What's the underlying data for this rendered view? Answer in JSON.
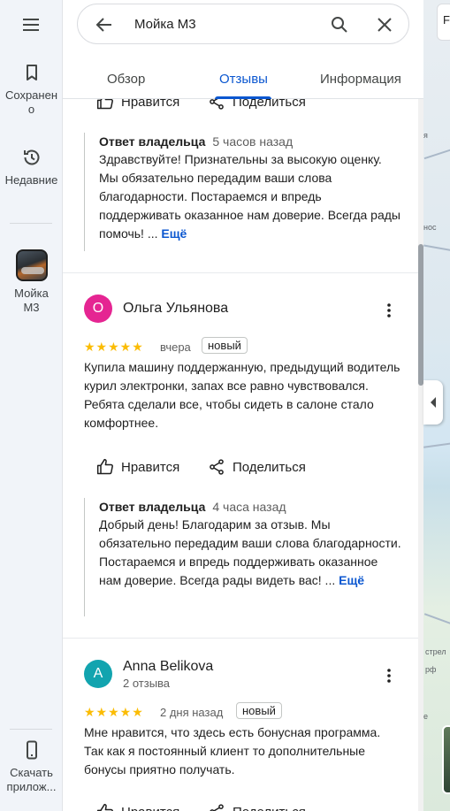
{
  "rail": {
    "saved": "Сохранено",
    "recent": "Недавние",
    "place": "Мойка М3",
    "download": "Скачать прилож..."
  },
  "search": {
    "query": "Мойка М3"
  },
  "tabs": {
    "overview": "Обзор",
    "reviews": "Отзывы",
    "info": "Информация"
  },
  "actions": {
    "like": "Нравится",
    "share": "Поделиться"
  },
  "reviews": [
    {
      "owner_reply": {
        "label": "Ответ владельца",
        "time": "5 часов назад",
        "text": "Здравствуйте! Признательны за высокую оценку. Мы обязательно передадим ваши слова благодарности. Постараемся и впредь поддерживать оказанное нам доверие. Всегда рады помочь! ...",
        "more": "Ещё"
      }
    },
    {
      "avatar_letter": "О",
      "avatar_color": "#e52592",
      "name": "Ольга Ульянова",
      "stars": "★★★★★",
      "rating": 5,
      "time": "вчера",
      "badge": "новый",
      "text": "Купила машину поддержанную, предыдущий водитель курил электронки, запах все равно чувствовался. Ребята сделали все, чтобы сидеть в салоне стало комфортнее.",
      "owner_reply": {
        "label": "Ответ владельца",
        "time": "4 часа назад",
        "text": "Добрый день! Благодарим за отзыв. Мы обязательно передадим ваши слова благодарности. Постараемся и впредь поддерживать оказанное нам доверие. Всегда рады видеть вас! ...",
        "more": "Ещё"
      }
    },
    {
      "avatar_letter": "A",
      "avatar_color": "#12a4af",
      "name": "Anna Belikova",
      "sub": "2 отзыва",
      "stars": "★★★★★",
      "rating": 5,
      "time": "2 дня назад",
      "badge": "новый",
      "text": "Мне нравится, что здесь есть бонусная программа. Так как я постоянный клиент то дополнительные бонусы приятно получать."
    }
  ],
  "map": {
    "chip": "F",
    "labels": [
      "я",
      "нос",
      "стрел",
      "рф",
      "е"
    ]
  },
  "colors": {
    "accent": "#0b57d0",
    "star": "#fbbc04"
  }
}
